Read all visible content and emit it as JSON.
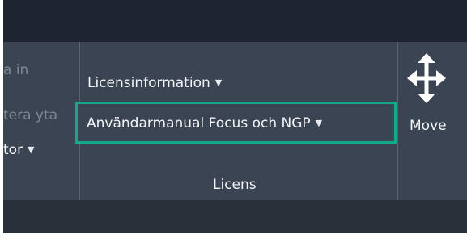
{
  "ribbon": {
    "left_panel": {
      "items": [
        {
          "label": "a in",
          "state": "disabled"
        },
        {
          "label": "tera yta",
          "state": "disabled"
        },
        {
          "label": "tor",
          "state": "enabled",
          "has_dropdown": true
        }
      ]
    },
    "licens_panel": {
      "buttons": [
        {
          "label": "Licensinformation",
          "has_dropdown": true
        },
        {
          "label": "Användarmanual Focus och NGP",
          "has_dropdown": true,
          "highlighted": true
        }
      ],
      "group_label": "Licens"
    },
    "move_tool": {
      "label": "Move",
      "icon": "move-arrows-icon"
    }
  },
  "colors": {
    "ribbon_bg": "#3b4453",
    "titlebar_bg": "#1e2530",
    "highlight_border": "#14a88c",
    "text": "#f3f5f7",
    "disabled_text": "#7e8794"
  }
}
